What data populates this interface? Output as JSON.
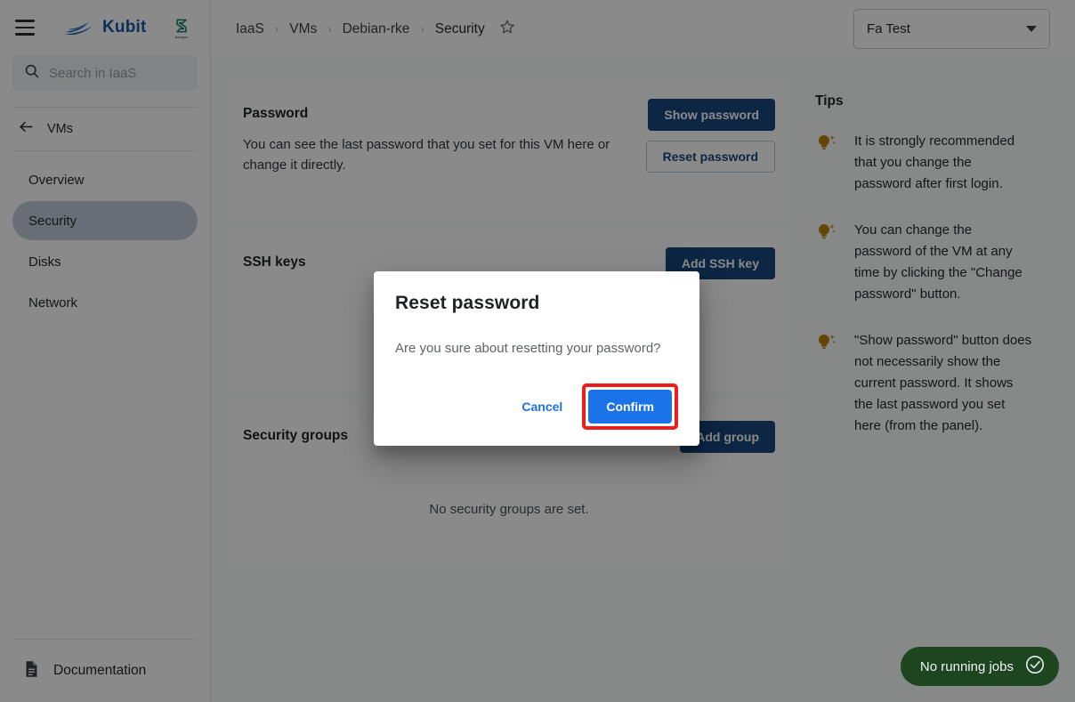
{
  "brand": {
    "name": "Kubit",
    "logo_icon": "ship-logo-icon",
    "partner_logo_icon": "partner-s-logo-icon",
    "partner_sub": "Nanjgen"
  },
  "sidebar": {
    "menu_icon": "hamburger-menu-icon",
    "search": {
      "icon": "search-icon",
      "placeholder": "Search in IaaS",
      "value": ""
    },
    "back": {
      "icon": "arrow-left-icon",
      "label": "VMs"
    },
    "items": [
      {
        "label": "Overview",
        "active": false
      },
      {
        "label": "Security",
        "active": true
      },
      {
        "label": "Disks",
        "active": false
      },
      {
        "label": "Network",
        "active": false
      }
    ],
    "documentation": {
      "icon": "document-icon",
      "label": "Documentation"
    }
  },
  "topbar": {
    "breadcrumbs": [
      "IaaS",
      "VMs",
      "Debian-rke",
      "Security"
    ],
    "separator": "›",
    "favorite_icon": "star-outline-icon",
    "env_select": {
      "value": "Fa Test",
      "caret_icon": "chevron-down-icon"
    }
  },
  "cards": {
    "password": {
      "title": "Password",
      "description": "You can see the last password that you set for this VM here or change it directly.",
      "show_button": "Show password",
      "reset_button": "Reset password"
    },
    "ssh": {
      "title": "SSH keys",
      "add_button": "Add SSH key"
    },
    "security_groups": {
      "title": "Security groups",
      "add_button": "Add group",
      "empty_text": "No security groups are set."
    }
  },
  "tips": {
    "title": "Tips",
    "icon": "lightbulb-icon",
    "items": [
      "It is strongly recommended that you change the password after first login.",
      "You can change the password of the VM at any time by clicking the \"Change password\" button.",
      "\"Show password\" button does not necessarily show the current password. It shows the last password you set here (from the panel)."
    ]
  },
  "modal": {
    "title": "Reset password",
    "message": "Are you sure about resetting your password?",
    "cancel_label": "Cancel",
    "confirm_label": "Confirm",
    "highlight_color": "#f01c1c",
    "confirm_color": "#1a73e8"
  },
  "jobs": {
    "label": "No running jobs",
    "icon": "check-circle-icon",
    "color": "#1d4620"
  }
}
